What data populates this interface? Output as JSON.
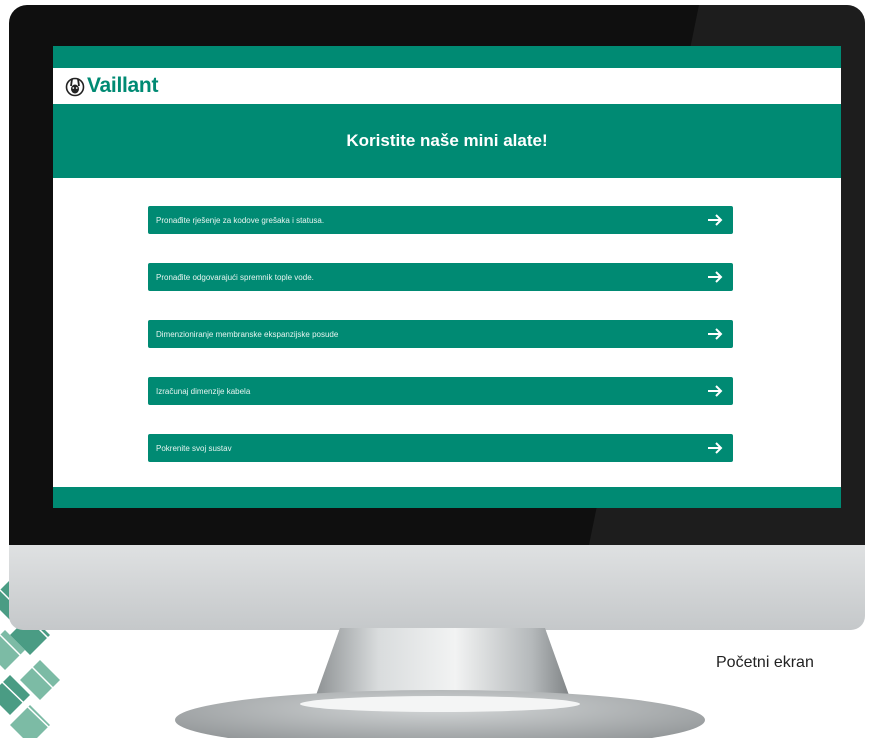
{
  "header": {
    "brand": "Vaillant"
  },
  "banner": {
    "title": "Koristite naše mini alate!"
  },
  "tools": [
    {
      "label": "Pronađite rješenje za kodove grešaka i statusa."
    },
    {
      "label": "Pronađite odgovarajući spremnik tople vode."
    },
    {
      "label": "Dimenzioniranje membranske ekspanzijske posude"
    },
    {
      "label": "Izračunaj dimenzije kabela"
    },
    {
      "label": "Pokrenite svoj sustav"
    }
  ],
  "caption": "Početni ekran",
  "icons": {
    "tool_arrow": "arrow-right-icon",
    "logo": "hare-logo-icon"
  },
  "colors": {
    "brand_green": "#008a73",
    "bezel": "#0f0f0f",
    "screen_bg": "#ffffff"
  }
}
